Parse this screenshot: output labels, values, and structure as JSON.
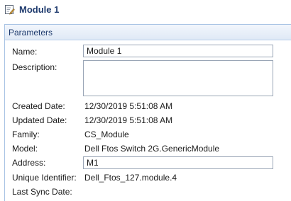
{
  "window": {
    "title": "Module 1",
    "icon": "edit-document-icon"
  },
  "panel": {
    "header": "Parameters"
  },
  "fields": {
    "name": {
      "label": "Name:",
      "value": "Module 1"
    },
    "description": {
      "label": "Description:",
      "value": ""
    },
    "created_date": {
      "label": "Created Date:",
      "value": "12/30/2019 5:51:08 AM"
    },
    "updated_date": {
      "label": "Updated Date:",
      "value": "12/30/2019 5:51:08 AM"
    },
    "family": {
      "label": "Family:",
      "value": "CS_Module"
    },
    "model": {
      "label": "Model:",
      "value": "Dell Ftos Switch 2G.GenericModule"
    },
    "address": {
      "label": "Address:",
      "value": "M1"
    },
    "unique_identifier": {
      "label": "Unique Identifier:",
      "value": "Dell_Ftos_127.module.4"
    },
    "last_sync_date": {
      "label": "Last Sync Date:",
      "value": ""
    }
  },
  "colors": {
    "title_text": "#1f3b6e",
    "panel_border": "#a9c4e4",
    "field_border": "#9aa6b6"
  }
}
